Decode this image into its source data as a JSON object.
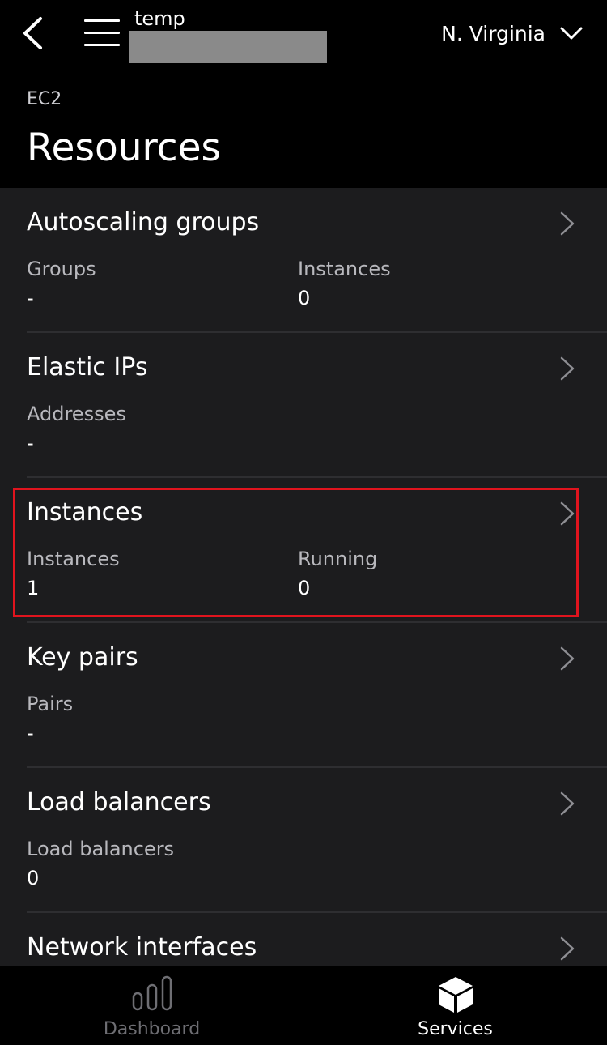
{
  "header": {
    "account_name": "temp",
    "region": "N. Virginia",
    "breadcrumb": "EC2",
    "title": "Resources"
  },
  "resources": [
    {
      "title": "Autoscaling groups",
      "metrics": [
        {
          "label": "Groups",
          "value": "-"
        },
        {
          "label": "Instances",
          "value": "0"
        }
      ]
    },
    {
      "title": "Elastic IPs",
      "metrics": [
        {
          "label": "Addresses",
          "value": "-"
        }
      ]
    },
    {
      "title": "Instances",
      "metrics": [
        {
          "label": "Instances",
          "value": "1"
        },
        {
          "label": "Running",
          "value": "0"
        }
      ]
    },
    {
      "title": "Key pairs",
      "metrics": [
        {
          "label": "Pairs",
          "value": "-"
        }
      ]
    },
    {
      "title": "Load balancers",
      "metrics": [
        {
          "label": "Load balancers",
          "value": "0"
        }
      ]
    },
    {
      "title": "Network interfaces",
      "metrics": []
    }
  ],
  "tabs": [
    {
      "label": "Dashboard",
      "icon": "bar-chart-icon",
      "active": false
    },
    {
      "label": "Services",
      "icon": "cube-icon",
      "active": true
    }
  ],
  "colors": {
    "header_bg": "#000000",
    "content_bg": "#1c1c1e",
    "highlight": "#e0141e",
    "inactive_tab": "#6e6e73"
  }
}
